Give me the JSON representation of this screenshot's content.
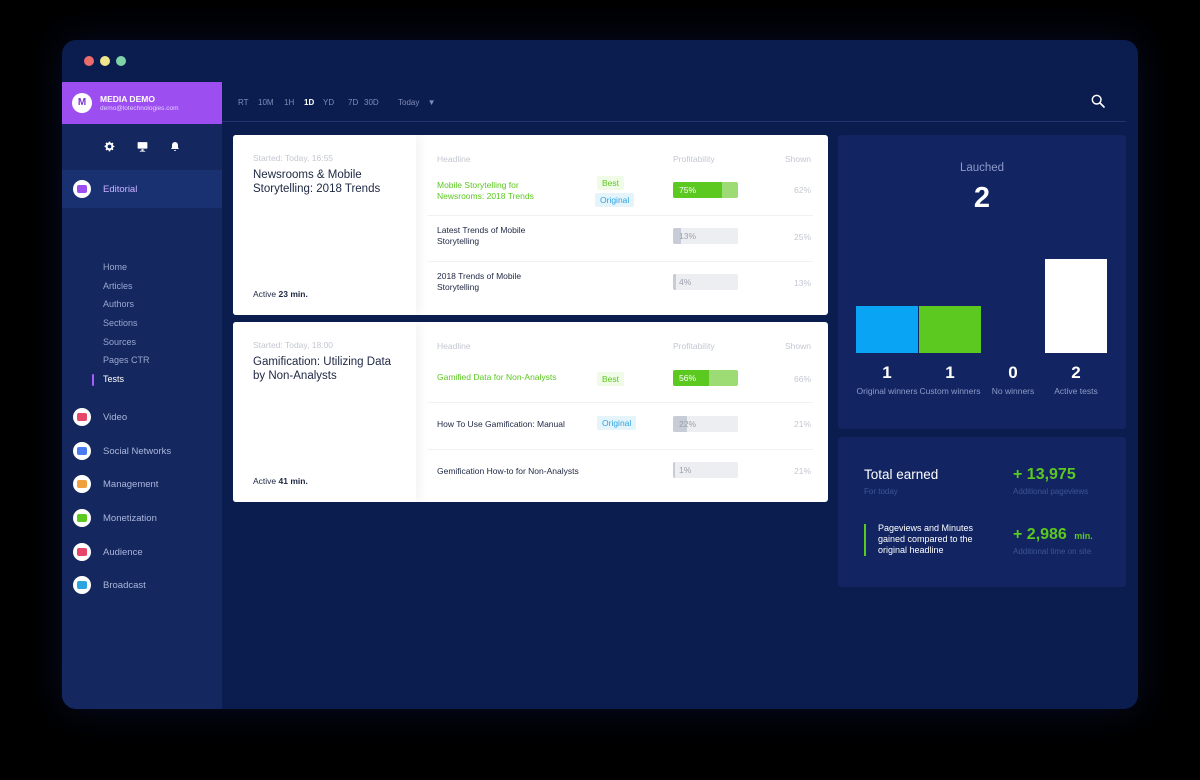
{
  "account": {
    "initial": "M",
    "name": "MEDIA DEMO",
    "email": "demo@lotechnologies.com"
  },
  "sidebar": {
    "top_icons": [
      "gear-icon",
      "monitor-icon",
      "bell-icon"
    ],
    "editorial_label": "Editorial",
    "sub_items": [
      "Home",
      "Articles",
      "Authors",
      "Sections",
      "Sources",
      "Pages CTR",
      "Tests"
    ],
    "active_sub": "Tests",
    "sections": [
      {
        "label": "Video",
        "icon": "video-icon",
        "color": "#e8456a"
      },
      {
        "label": "Social Networks",
        "icon": "megaphone-icon",
        "color": "#4b7bf0"
      },
      {
        "label": "Management",
        "icon": "target-icon",
        "color": "#f0a03c"
      },
      {
        "label": "Monetization",
        "icon": "money-icon",
        "color": "#5bc91f"
      },
      {
        "label": "Audience",
        "icon": "people-icon",
        "color": "#e8456a"
      },
      {
        "label": "Broadcast",
        "icon": "tv-icon",
        "color": "#2ba4e0"
      }
    ]
  },
  "timeframes": [
    "RT",
    "10M",
    "1H",
    "1D",
    "YD",
    "7D",
    "30D"
  ],
  "selected_timeframe": "1D",
  "date_select": "Today",
  "tests": [
    {
      "started": "Started: Today, 16:55",
      "title": "Newsrooms & Mobile Storytelling: 2018 Trends",
      "active_prefix": "Active",
      "active_value": "23 min.",
      "col_headline": "Headline",
      "col_profit": "Profitability",
      "col_shown": "Shown",
      "rows": [
        {
          "headline": "Mobile Storytelling for Newsrooms: 2018 Trends",
          "winner": true,
          "badges": [
            "Best",
            "Original"
          ],
          "profit": "75%",
          "profit_value": 75,
          "shown": "62%"
        },
        {
          "headline": "Latest Trends of Mobile Storytelling",
          "winner": false,
          "badges": [],
          "profit": "13%",
          "profit_value": 13,
          "shown": "25%"
        },
        {
          "headline": "2018 Trends of Mobile Storytelling",
          "winner": false,
          "badges": [],
          "profit": "4%",
          "profit_value": 4,
          "shown": "13%"
        }
      ]
    },
    {
      "started": "Started: Today, 18:00",
      "title": "Gamification: Utilizing Data by Non-Analysts",
      "active_prefix": "Active",
      "active_value": "41 min.",
      "col_headline": "Headline",
      "col_profit": "Profitability",
      "col_shown": "Shown",
      "rows": [
        {
          "headline": "Gamified Data for Non-Analysts",
          "winner": true,
          "badges": [
            "Best"
          ],
          "profit": "56%",
          "profit_value": 56,
          "shown": "66%"
        },
        {
          "headline": "How To Use Gamification: Manual",
          "winner": false,
          "badges": [
            "Original"
          ],
          "profit": "22%",
          "profit_value": 22,
          "shown": "21%"
        },
        {
          "headline": "Gemification How-to for Non-Analysts",
          "winner": false,
          "badges": [],
          "profit": "1%",
          "profit_value": 1,
          "shown": "21%"
        }
      ]
    }
  ],
  "launched": {
    "label": "Lauched",
    "value": "2",
    "columns": [
      {
        "value": 1,
        "label": "Original winners",
        "color": "#0aa4f5"
      },
      {
        "value": 1,
        "label": "Custom winners",
        "color": "#5bc91f"
      },
      {
        "value": 0,
        "label": "No winners",
        "color": "#0b1c4e"
      },
      {
        "value": 2,
        "label": "Active tests",
        "color": "#ffffff"
      }
    ]
  },
  "earnings": {
    "title": "Total earned",
    "subtitle": "For today",
    "pageviews_value": "+ 13,975",
    "pageviews_label": "Additional pageviews",
    "note": "Pageviews and Minutes gained compared to the original headline",
    "minutes_value": "+ 2,986",
    "minutes_unit": "min.",
    "minutes_label": "Additional time on site",
    "accent": "#5bc91f"
  }
}
